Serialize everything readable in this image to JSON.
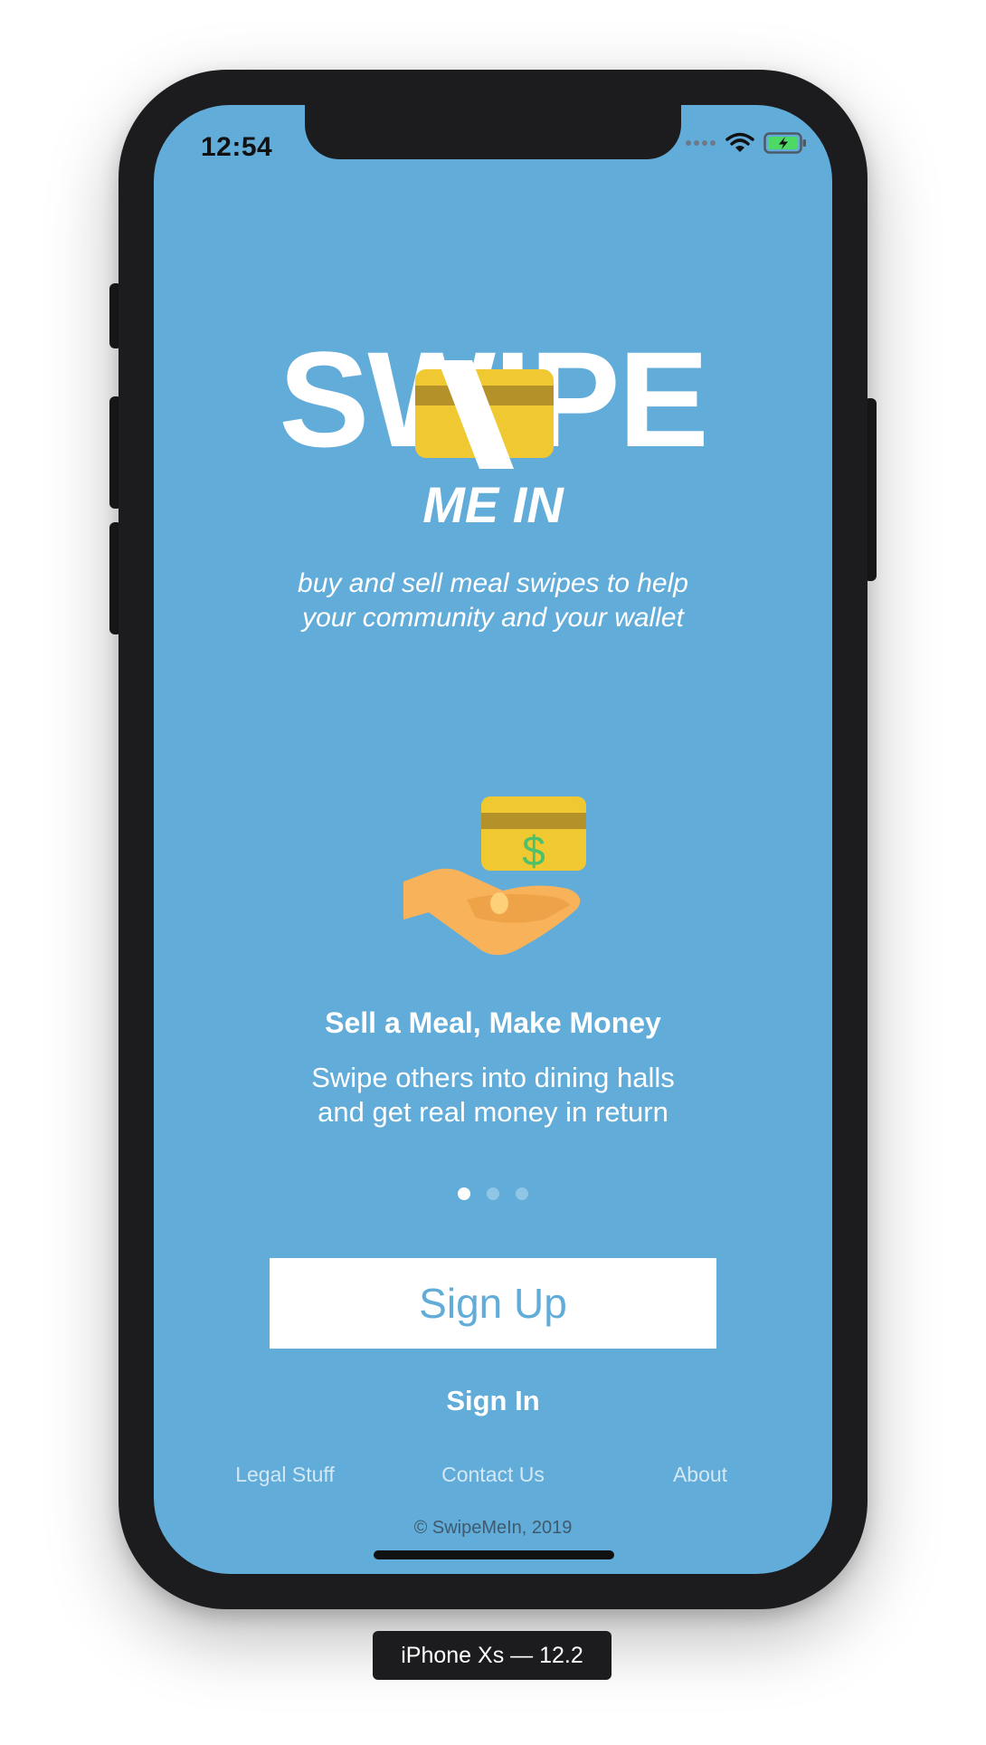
{
  "status_bar": {
    "time": "12:54",
    "icons": [
      "cellular-dots-icon",
      "wifi-icon",
      "battery-charging-icon"
    ]
  },
  "logo": {
    "title": "SWIPE",
    "subtitle": "ME IN"
  },
  "tagline": {
    "line1": "buy and sell meal swipes to help",
    "line2": "your community and your wallet"
  },
  "onboarding": {
    "title": "Sell a Meal, Make Money",
    "desc_line1": "Swipe others into dining halls",
    "desc_line2": "and get real money in return",
    "page_count": 3,
    "active_page": 0
  },
  "actions": {
    "sign_up": "Sign Up",
    "sign_in": "Sign In"
  },
  "footer": {
    "links": [
      "Legal Stuff",
      "Contact Us",
      "About"
    ],
    "copyright": "© SwipeMeIn, 2019"
  },
  "device_label": "iPhone Xs — 12.2",
  "colors": {
    "background": "#62acda",
    "card_yellow": "#f0c832",
    "card_stripe": "#b5912a",
    "hand": "#f8b25a",
    "dollar": "#4cc06a",
    "bezel": "#1c1c1e"
  }
}
